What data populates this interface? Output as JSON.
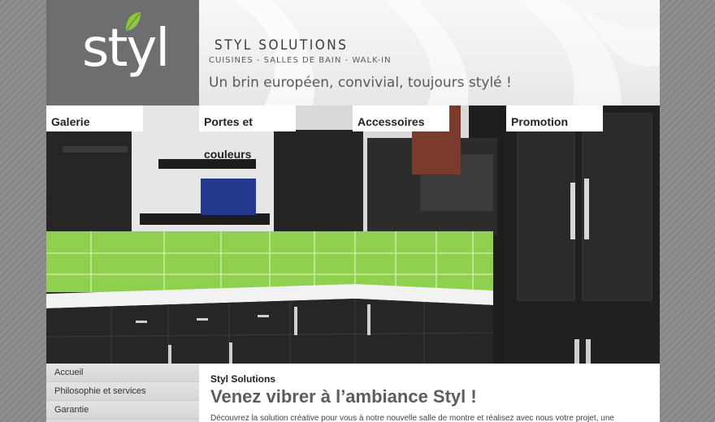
{
  "logo": {
    "text": "styl"
  },
  "header": {
    "brand": "STYL SOLUTIONS",
    "subtitle": "CUISINES - SALLES DE BAIN - WALK-IN",
    "tagline": "Un brin européen, convivial, toujours stylé !"
  },
  "nav": {
    "tabs": [
      {
        "label": "Galerie"
      },
      {
        "label": "Portes et couleurs"
      },
      {
        "label": "Accessoires"
      },
      {
        "label": "Promotion"
      }
    ]
  },
  "sidebar": {
    "items": [
      {
        "label": "Accueil"
      },
      {
        "label": "Philosophie et services"
      },
      {
        "label": "Garantie"
      }
    ]
  },
  "content": {
    "title": "Styl Solutions",
    "heading": "Venez vibrer à l’ambiance Styl !",
    "body": "Découvrez la solution créative pour vous à notre nouvelle salle de montre et réalisez avec nous votre projet, une"
  },
  "colors": {
    "logo_bg": "#6d6e70",
    "leaf": "#8dc63f",
    "backsplash": "#8fd14f"
  }
}
